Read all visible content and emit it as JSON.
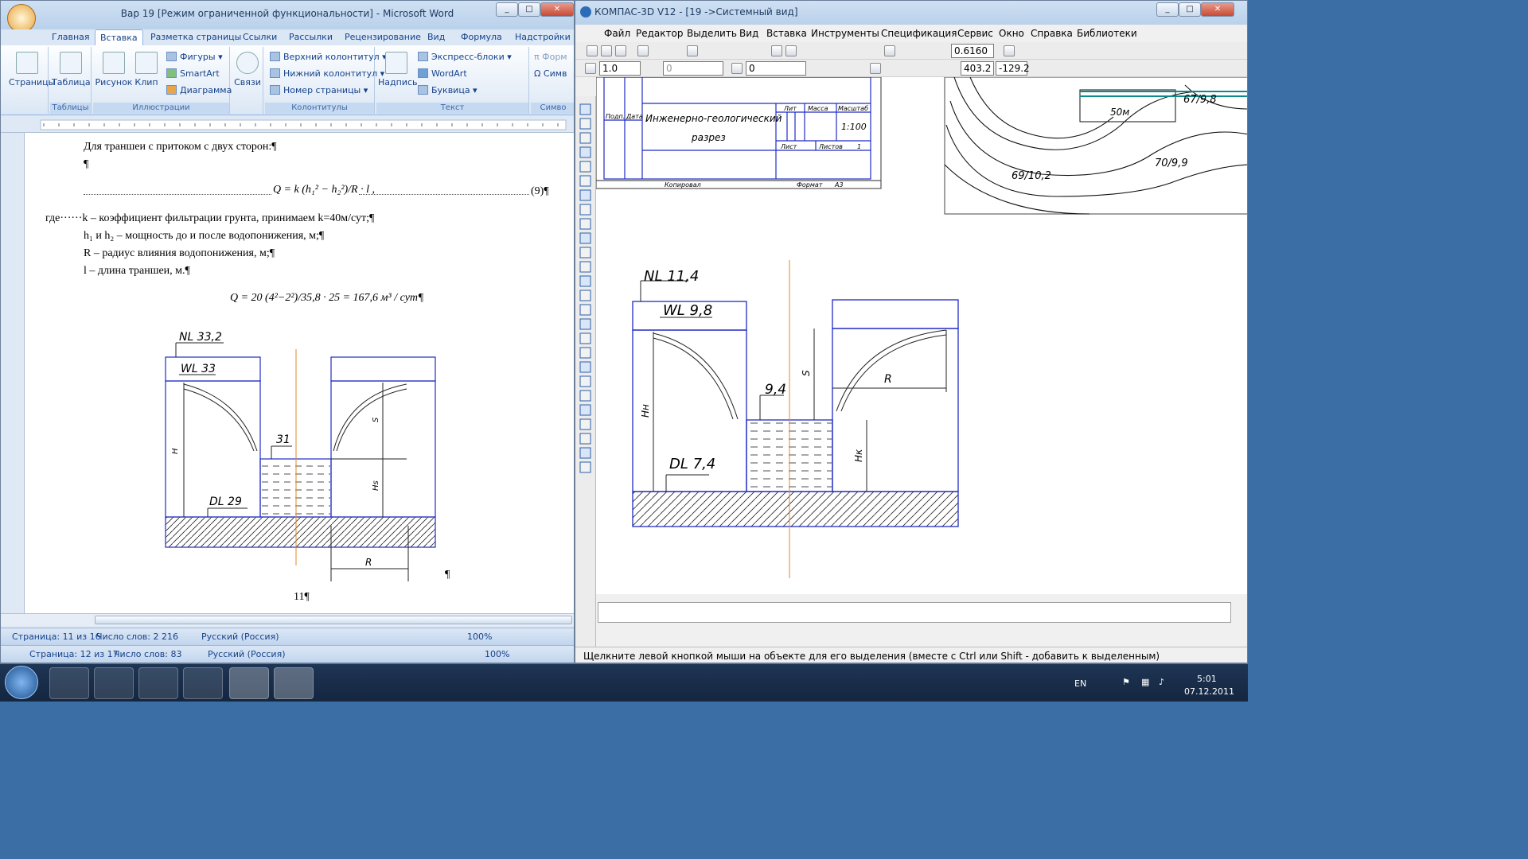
{
  "word": {
    "title": "Вар 19 [Режим ограниченной функциональности] - Microsoft Word",
    "tabs": [
      "Главная",
      "Вставка",
      "Разметка страницы",
      "Ссылки",
      "Рассылки",
      "Рецензирование",
      "Вид",
      "Формула",
      "Надстройки"
    ],
    "active_tab": "Вставка",
    "ribbon": {
      "pages": "Страницы",
      "table": "Таблица",
      "picture": "Рисунок",
      "clip": "Клип",
      "shapes": "Фигуры",
      "smartart": "SmartArt",
      "chart": "Диаграмма",
      "links": "Связи",
      "header": "Верхний колонтитул",
      "footer": "Нижний колонтитул",
      "page_number": "Номер страницы",
      "textbox": "Надпись",
      "express": "Экспресс-блоки",
      "wordart": "WordArt",
      "dropcap": "Буквица",
      "formula": "Форм",
      "symbol": "Симв",
      "groups": [
        "Таблицы",
        "Иллюстрации",
        "Колонтитулы",
        "Текст",
        "Симво"
      ]
    },
    "doc": {
      "l1": "Для траншеи с притоком с двух сторон:¶",
      "l2": "¶",
      "formula9": "Q = k (h₁² − h₂²)/R · l ,",
      "formula9_num": "(9)¶",
      "l_where": "где······k – коэффициент фильтрации грунта, принимаем k=40м/сут;¶",
      "l_h": "h₁ и h₂ – мощность до и после водопонижения, м;¶",
      "l_r": "R – радиус влияния водопонижения, м;¶",
      "l_l": "l – длина траншеи, м.¶",
      "calc": "Q = 20 (4²−2²)/35,8 · 25 = 167,6 м³ / сут¶",
      "nl": "NL 33,2",
      "wl": "WL 33",
      "val31": "31",
      "dl": "DL 29",
      "h_label": "H",
      "s_label": "S",
      "hs_label": "Hs",
      "r_label": "R",
      "pilcrow": "¶",
      "page_num": "11¶"
    },
    "status": {
      "page": "Страница: 11 из 16",
      "words": "Число слов: 2 216",
      "lang": "Русский (Россия)",
      "zoom": "100%"
    },
    "status2": {
      "page": "Страница: 12 из 17",
      "words": "Число слов: 83",
      "lang": "Русский (Россия)",
      "zoom": "100%"
    }
  },
  "kompas": {
    "title": "КОМПАС-3D V12 - [19 ->Системный вид]",
    "menu": [
      "Файл",
      "Редактор",
      "Выделить",
      "Вид",
      "Вставка",
      "Инструменты",
      "Спецификация",
      "Сервис",
      "Окно",
      "Справка",
      "Библиотеки"
    ],
    "toolbar": {
      "zoom": "0.6160",
      "line": "1.0",
      "style": "0",
      "layer": "0",
      "coord_x": "403.2",
      "coord_y": "-129.2"
    },
    "stamp": {
      "title": "Инженерно-геологический разрез",
      "podp": "Подп.",
      "data": "Дата",
      "lit": "Лит",
      "massa": "Масса",
      "masshtab": "Масштаб",
      "scale": "1:100",
      "list": "Лист",
      "listov": "Листов",
      "listov_n": "1",
      "kopiroval": "Копировал",
      "format": "Формат",
      "format_v": "А3"
    },
    "map": {
      "m50": "50м",
      "p1": "67/9,8",
      "p2": "69/10,2",
      "p3": "70/9,9"
    },
    "drawing": {
      "nl": "NL 11,4",
      "wl": "WL 9,8",
      "val94": "9,4",
      "dl": "DL 7,4",
      "h_label": "Hн",
      "s_label": "S",
      "hs_label": "Hк",
      "r_label": "R"
    },
    "status": "Щелкните левой кнопкой мыши на объекте для его выделения (вместе с Ctrl или Shift - добавить к выделенным)"
  },
  "taskbar": {
    "lang": "EN",
    "time": "5:01",
    "date": "07.12.2011"
  }
}
